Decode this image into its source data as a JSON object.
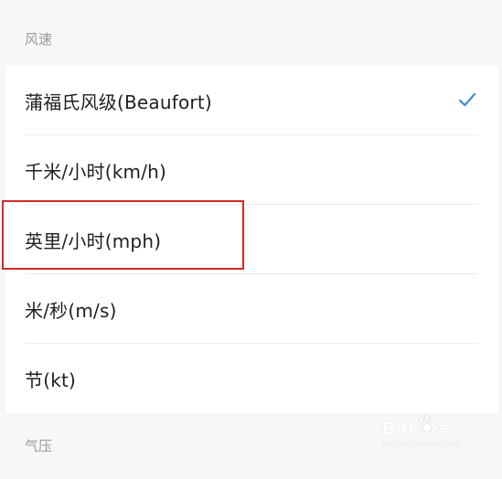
{
  "sections": {
    "wind_speed_header": "风速",
    "pressure_header": "气压"
  },
  "wind_speed_options": [
    {
      "label": "蒲福氏风级(Beaufort)",
      "selected": true
    },
    {
      "label": "千米/小时(km/h)",
      "selected": false
    },
    {
      "label": "英里/小时(mph)",
      "selected": false
    },
    {
      "label": "米/秒(m/s)",
      "selected": false
    },
    {
      "label": "节(kt)",
      "selected": false
    }
  ],
  "colors": {
    "check": "#3b8ed6",
    "highlight": "#d42a2a",
    "header_bg": "#f7f7f7",
    "header_text": "#9a9a9a"
  },
  "watermark": {
    "brand": "Bai 经验",
    "site": "jingyan.baidu.com"
  }
}
